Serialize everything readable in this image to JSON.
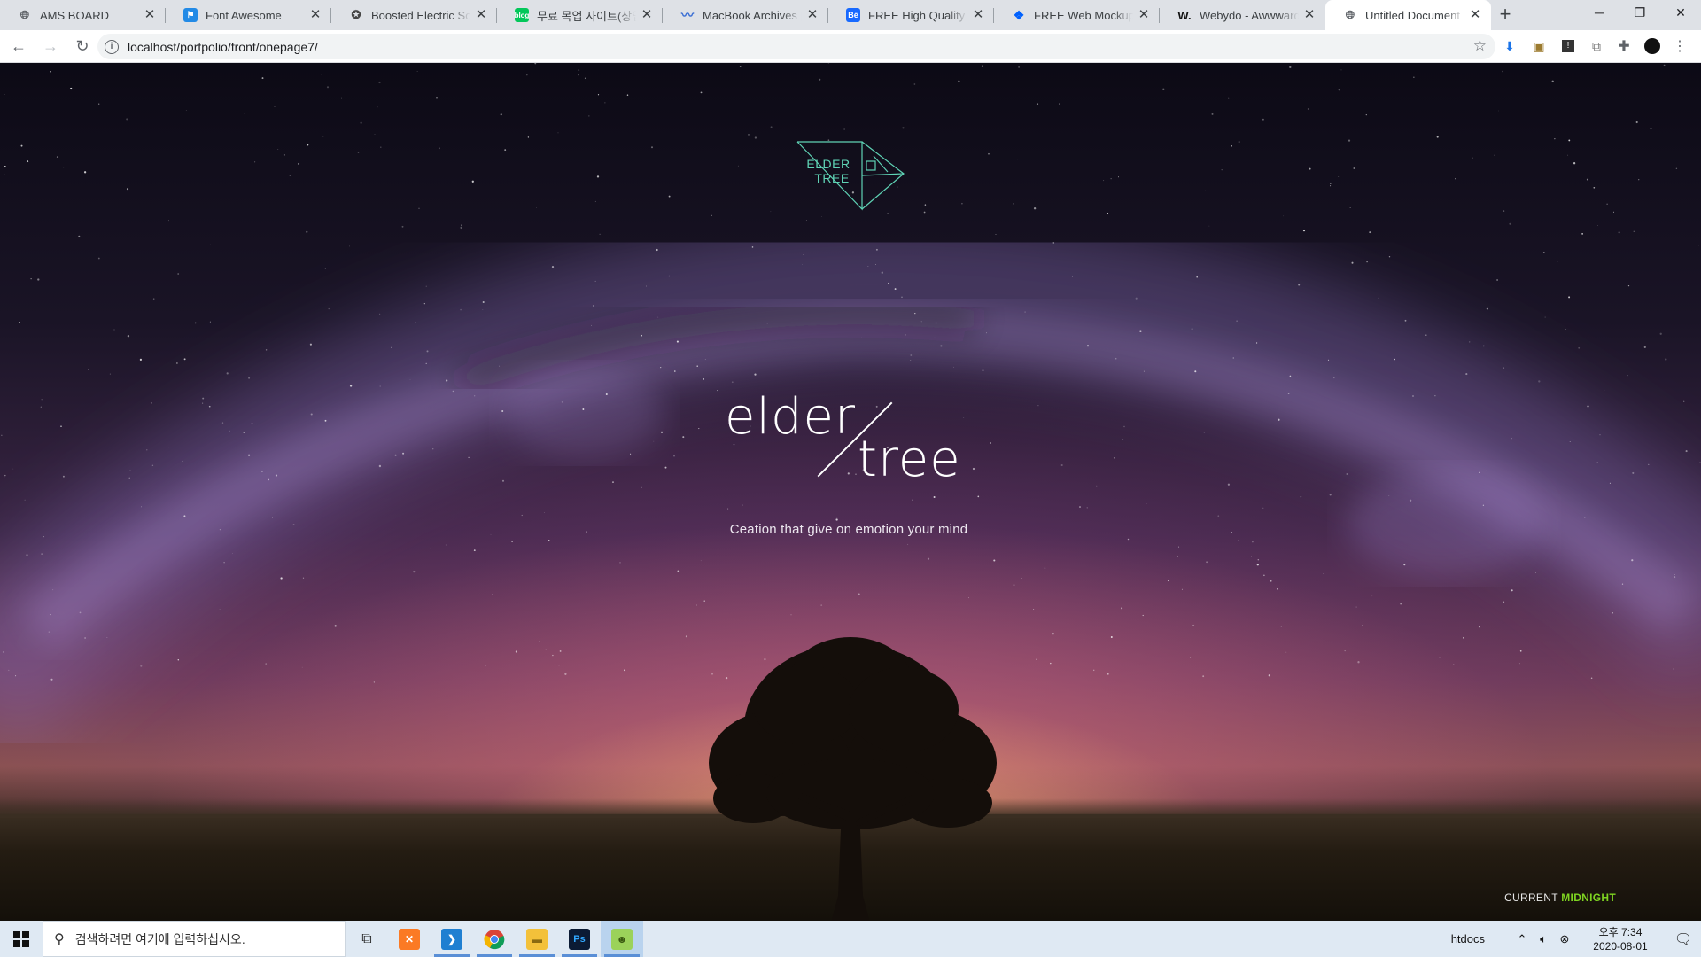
{
  "browser": {
    "tabs": [
      {
        "title": "AMS BOARD",
        "favicon": "globe-icon",
        "color": "#5f6368"
      },
      {
        "title": "Font Awesome",
        "favicon": "flag-icon",
        "color": "#228ae6"
      },
      {
        "title": "Boosted Electric Scooters",
        "favicon": "boosted-icon",
        "color": "#444444"
      },
      {
        "title": "무료 목업 사이트(상업",
        "favicon": "blog-icon",
        "color": "#03c75a"
      },
      {
        "title": "MacBook Archives | Pe",
        "favicon": "wave-icon",
        "color": "#3b6fd4"
      },
      {
        "title": "FREE High Quality We",
        "favicon": "behance-icon",
        "color": "#1769ff"
      },
      {
        "title": "FREE Web Mockup by",
        "favicon": "dropbox-icon",
        "color": "#0061fe"
      },
      {
        "title": "Webydo - Awwwards",
        "favicon": "w-icon",
        "color": "#111111"
      },
      {
        "title": "Untitled Document",
        "favicon": "globe-icon",
        "color": "#5f6368",
        "active": true
      }
    ],
    "url": "localhost/portpolio/front/onepage7/"
  },
  "page": {
    "logo": {
      "line1": "ELDER",
      "line2": "TREE",
      "color": "#5fd3b5"
    },
    "hero": {
      "word1": "elder",
      "word2": "tree"
    },
    "tagline": "Ceation that give on emotion your mind",
    "status": {
      "prefix": "CURRENT",
      "value": "MIDNIGHT",
      "accent": "#7ed321"
    }
  },
  "taskbar": {
    "search_placeholder": "검색하려면 여기에 입력하십시오.",
    "apps": [
      {
        "name": "task-view-icon"
      },
      {
        "name": "xampp-icon"
      },
      {
        "name": "vscode-icon"
      },
      {
        "name": "chrome-icon"
      },
      {
        "name": "file-explorer-icon"
      },
      {
        "name": "photoshop-icon"
      },
      {
        "name": "game-icon"
      }
    ],
    "tray_label": "htdocs",
    "time": "오후 7:34",
    "date": "2020-08-01"
  }
}
